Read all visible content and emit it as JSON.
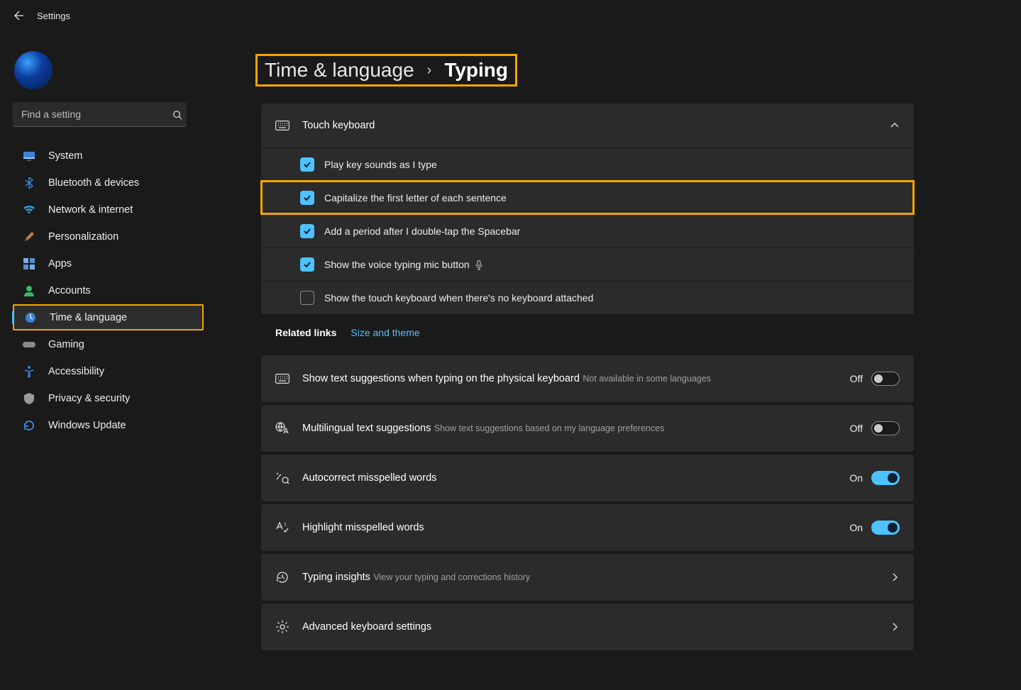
{
  "titlebar": {
    "title": "Settings"
  },
  "search": {
    "placeholder": "Find a setting"
  },
  "sidebar": {
    "items": [
      {
        "label": "System"
      },
      {
        "label": "Bluetooth & devices"
      },
      {
        "label": "Network & internet"
      },
      {
        "label": "Personalization"
      },
      {
        "label": "Apps"
      },
      {
        "label": "Accounts"
      },
      {
        "label": "Time & language"
      },
      {
        "label": "Gaming"
      },
      {
        "label": "Accessibility"
      },
      {
        "label": "Privacy & security"
      },
      {
        "label": "Windows Update"
      }
    ]
  },
  "breadcrumb": {
    "parent": "Time & language",
    "current": "Typing"
  },
  "touchKeyboard": {
    "title": "Touch keyboard",
    "items": [
      {
        "label": "Play key sounds as I type",
        "checked": true
      },
      {
        "label": "Capitalize the first letter of each sentence",
        "checked": true
      },
      {
        "label": "Add a period after I double-tap the Spacebar",
        "checked": true
      },
      {
        "label": "Show the voice typing mic button",
        "checked": true
      },
      {
        "label": "Show the touch keyboard when there's no keyboard attached",
        "checked": false
      }
    ]
  },
  "related": {
    "label": "Related links",
    "link": "Size and theme"
  },
  "toggles": [
    {
      "title": "Show text suggestions when typing on the physical keyboard",
      "sub": "Not available in some languages",
      "state": "Off",
      "on": false
    },
    {
      "title": "Multilingual text suggestions",
      "sub": "Show text suggestions based on my language preferences",
      "state": "Off",
      "on": false
    },
    {
      "title": "Autocorrect misspelled words",
      "sub": "",
      "state": "On",
      "on": true
    },
    {
      "title": "Highlight misspelled words",
      "sub": "",
      "state": "On",
      "on": true
    }
  ],
  "links": [
    {
      "title": "Typing insights",
      "sub": "View your typing and corrections history"
    },
    {
      "title": "Advanced keyboard settings",
      "sub": ""
    }
  ]
}
